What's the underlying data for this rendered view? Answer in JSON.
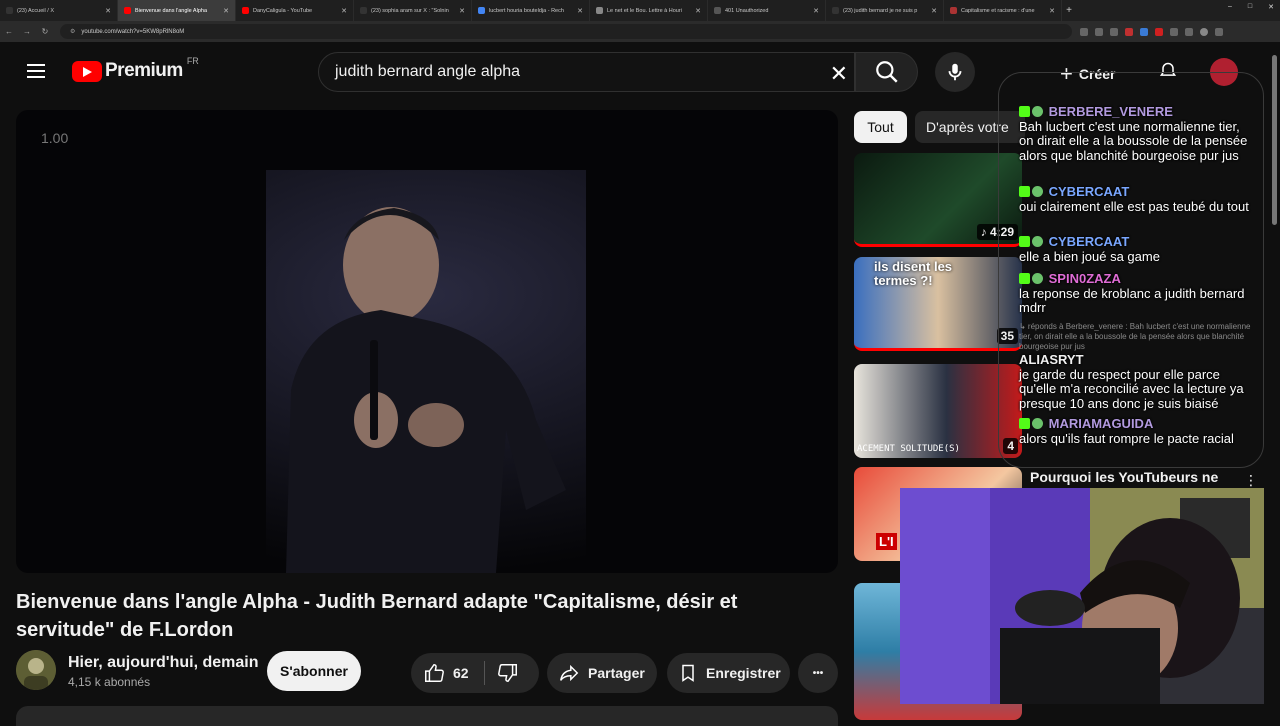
{
  "browser": {
    "tabs": [
      {
        "title": "(23) Accueil / X",
        "icon_color": "#333333",
        "active": false
      },
      {
        "title": "Bienvenue dans l'angle Alpha",
        "icon_color": "#ff0000",
        "active": true
      },
      {
        "title": "DanyCaligula - YouTube",
        "icon_color": "#ff0000",
        "active": false
      },
      {
        "title": "(23) sophia aram sur X : \"Solnin",
        "icon_color": "#333333",
        "active": false
      },
      {
        "title": "lucbert houria bouteldja - Rech",
        "icon_color": "#4285f4",
        "active": false
      },
      {
        "title": "Le net et le Bou. Lettre à Houri",
        "icon_color": "#888888",
        "active": false
      },
      {
        "title": "401 Unauthorized",
        "icon_color": "#555555",
        "active": false
      },
      {
        "title": "(23) judith bernard je ne suis p",
        "icon_color": "#333333",
        "active": false
      },
      {
        "title": "Capitalisme et racisme : d'une",
        "icon_color": "#aa3333",
        "active": false
      }
    ],
    "new_tab": "+",
    "window_controls": [
      "–",
      "□",
      "✕"
    ],
    "url": "youtube.com/watch?v=5KW8pRlN8oM"
  },
  "header": {
    "logo": "Premium",
    "country": "FR",
    "search_value": "judith bernard angle alpha",
    "create_label": "Créer"
  },
  "player": {
    "speed_overlay": "1.00"
  },
  "video": {
    "title": "Bienvenue dans l'angle Alpha - Judith Bernard adapte \"Capitalisme, désir et servitude\" de F.Lordon",
    "channel_name": "Hier, aujourd'hui, demain",
    "subscribers": "4,15 k abonnés",
    "subscribe_label": "S'abonner",
    "likes": "62",
    "share_label": "Partager",
    "save_label": "Enregistrer",
    "more_label": "•••"
  },
  "filters": {
    "all": "Tout",
    "second": "D'après votre"
  },
  "related": [
    {
      "duration": "4:29",
      "music": true
    },
    {
      "duration": "35",
      "overlay_text": "ils disent les termes ?!"
    },
    {
      "duration": "4",
      "overlay_text": "ACEMENT SOLITUDE(S)"
    },
    {
      "duration": "",
      "overlay_text": "L'I"
    },
    {
      "title": "Pourquoi les YouTubeurs ne"
    }
  ],
  "chat": {
    "messages": [
      {
        "user": "BERBERE_VENERE",
        "user_color": "#b29adf",
        "text": "Bah lucbert c'est une normalienne tier, on dirait elle a la boussole de la pensée alors que blanchité bourgeoise pur jus"
      },
      {
        "user": "CYBERCAAT",
        "user_color": "#7aa7ff",
        "text": "oui clairement elle est pas teubé du tout"
      },
      {
        "user": "CYBERCAAT",
        "user_color": "#7aa7ff",
        "text": "elle a bien joué sa game"
      },
      {
        "user": "SPIN0ZAZA",
        "user_color": "#e06cd6",
        "text": "la reponse de kroblanc a judith bernard mdrr"
      },
      {
        "user": "ALIASRYT",
        "user_color": "#f1f1f1",
        "text": "je garde du respect pour elle parce qu'elle m'a reconcilié avec la lecture ya presque 10 ans donc je suis biaisé"
      },
      {
        "user": "MARIAMAGUIDA",
        "user_color": "#b29adf",
        "text": "alors qu'ils faut rompre le pacte racial"
      }
    ],
    "reply_quote": "↳ réponds à Berbere_venere : Bah lucbert c'est une normalienne tier, on dirait elle a la boussole de la pensée alors que blanchité bourgeoise pur jus"
  }
}
